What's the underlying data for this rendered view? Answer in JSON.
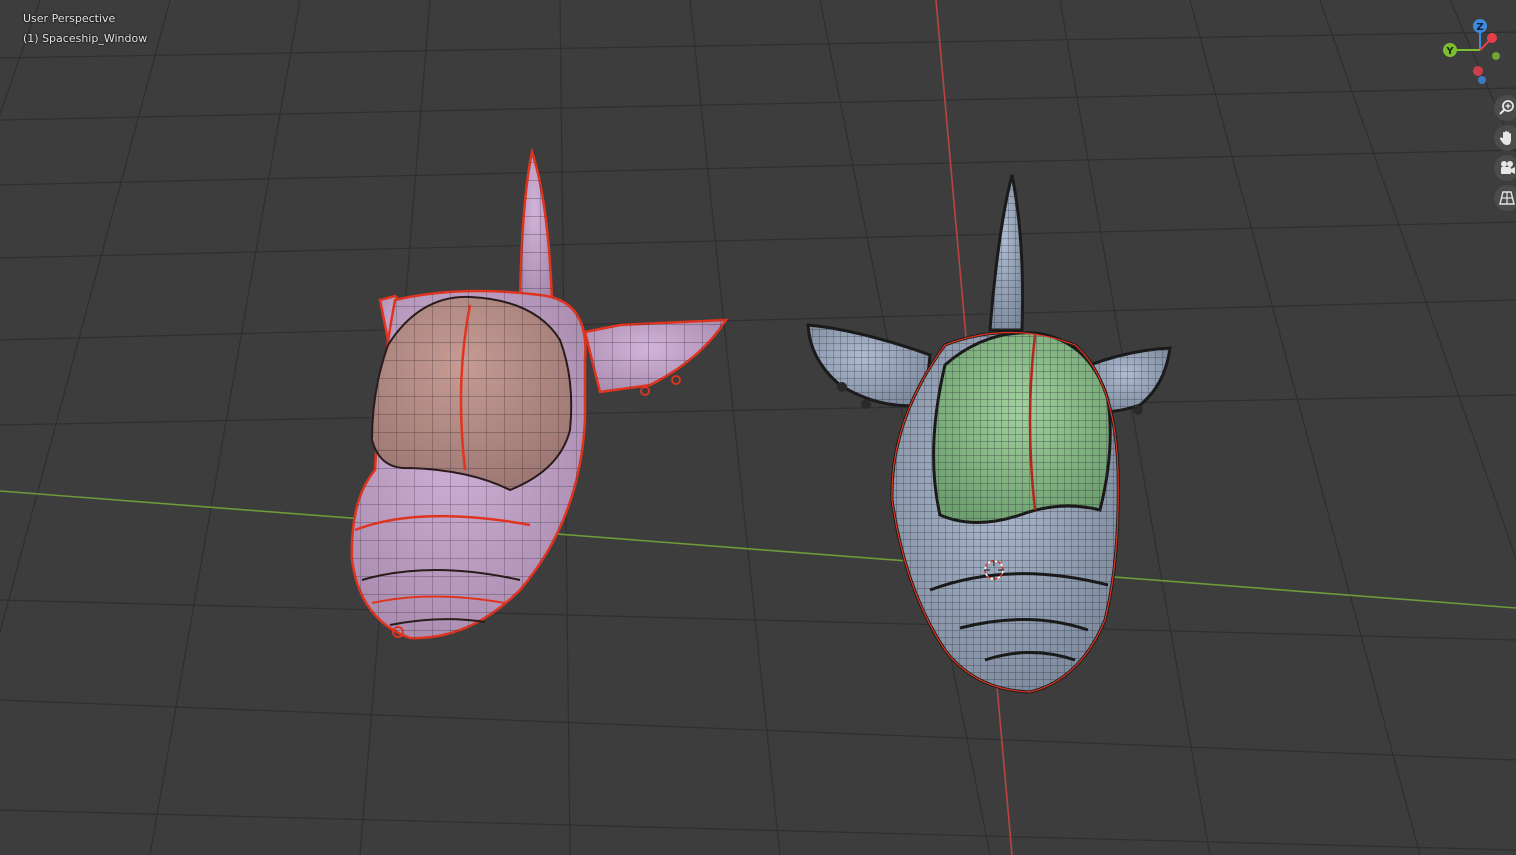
{
  "viewport": {
    "view_mode": "User Perspective",
    "active_object": "(1) Spaceship_Window"
  },
  "navigation_gizmo": {
    "axes": {
      "z": "Z",
      "y": "Y",
      "x": "X"
    },
    "colors": {
      "x": "#e5404a",
      "y": "#7bbf2e",
      "z": "#3d8ae0"
    }
  },
  "nav_buttons": [
    {
      "name": "zoom",
      "icon": "zoom-icon"
    },
    {
      "name": "pan",
      "icon": "hand-icon"
    },
    {
      "name": "camera",
      "icon": "camera-icon"
    },
    {
      "name": "perspective",
      "icon": "grid-icon"
    }
  ],
  "scene": {
    "background": "#3d3d3d",
    "grid_line": "#2e2e2e",
    "x_axis_color": "#6d9a3a",
    "y_axis_color": "#b8453f",
    "selection_outline": "#e0341f",
    "low_poly_body": "#c9a7d2",
    "low_poly_window": "#b88f88",
    "high_poly_body": "#9aaabf",
    "high_poly_window": "#8fc08e"
  }
}
